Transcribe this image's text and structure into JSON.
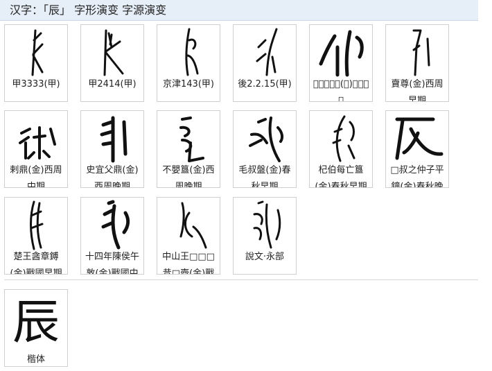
{
  "header": {
    "title": "汉字：「辰」 字形演变 字源演变"
  },
  "rows": [
    [
      {
        "caption": "甲3333(甲)",
        "glyph": "oracle-bone-glyph"
      },
      {
        "caption": "甲2414(甲)",
        "glyph": "oracle-bone-glyph"
      },
      {
        "caption": "京津143(甲)",
        "glyph": "oracle-bone-glyph"
      },
      {
        "caption": "後2.2.15(甲)",
        "glyph": "oracle-bone-glyph"
      },
      {
        "caption": "𨑶作且丁鼎(金)西周早期",
        "glyph": "bronze-glyph"
      },
      {
        "caption": "𧶠尊(金)西周早期",
        "glyph": "bronze-glyph"
      }
    ],
    [
      {
        "caption": "剌鼎(金)西周中期",
        "glyph": "bronze-glyph"
      },
      {
        "caption": "史宜父鼎(金)西周晚期",
        "glyph": "bronze-glyph"
      },
      {
        "caption": "不嬰簋(金)西周晚期",
        "glyph": "bronze-glyph"
      },
      {
        "caption": "毛叔盤(金)春秋早期",
        "glyph": "bronze-glyph"
      },
      {
        "caption": "杞伯每亡簋(金)春秋早期",
        "glyph": "bronze-glyph"
      },
      {
        "caption": "□叔之仲子平鐘(金)春秋晚期",
        "glyph": "bronze-glyph"
      }
    ],
    [
      {
        "caption": "楚王酓章鎛(金)戰國早期",
        "glyph": "bronze-glyph"
      },
      {
        "caption": "十四年陳侯午敦(金)戰國中期",
        "glyph": "bronze-glyph"
      },
      {
        "caption": "中山王□□□昔□壺(金)戰國晚期",
        "glyph": "bronze-glyph"
      },
      {
        "caption": "說文‧永部",
        "glyph": "seal-script-glyph"
      }
    ]
  ],
  "kaishu": {
    "char": "辰",
    "caption": "楷体"
  }
}
